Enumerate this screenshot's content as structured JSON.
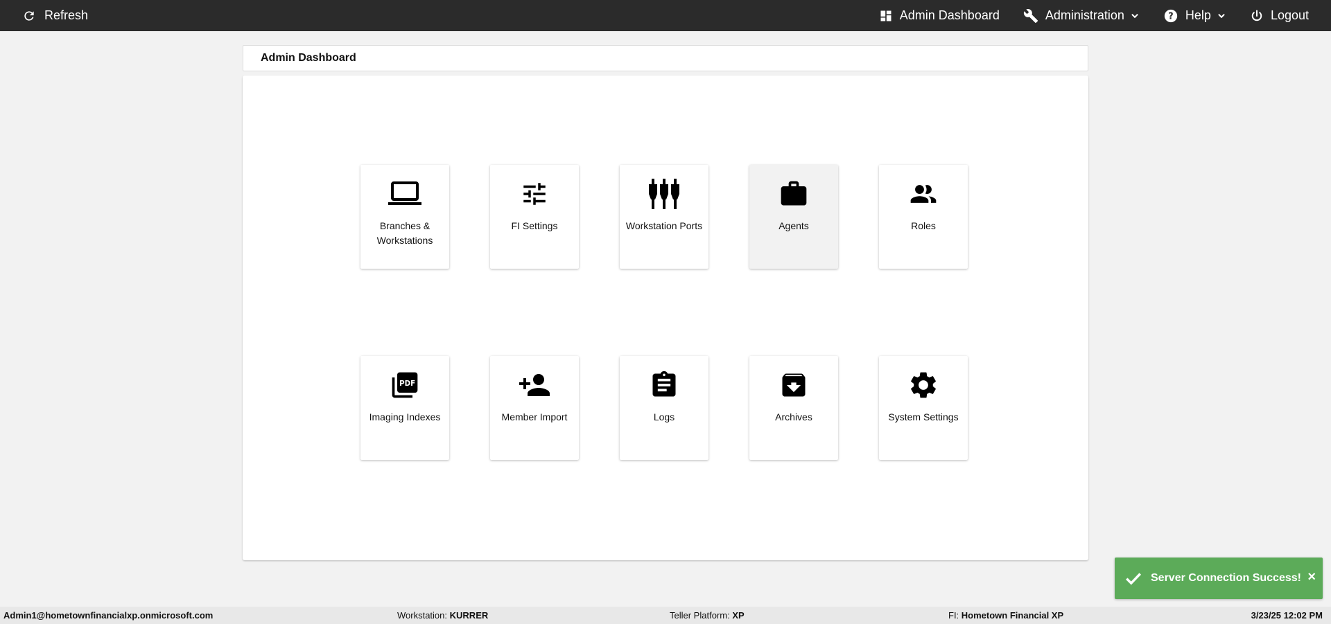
{
  "topbar": {
    "refresh_label": "Refresh",
    "nav": {
      "admin_dashboard": "Admin Dashboard",
      "administration": "Administration",
      "help": "Help",
      "logout": "Logout"
    }
  },
  "header": {
    "title": "Admin Dashboard"
  },
  "tiles": [
    {
      "label": "Branches & Workstations",
      "icon": "laptop-icon"
    },
    {
      "label": "FI Settings",
      "icon": "tune-icon"
    },
    {
      "label": "Workstation Ports",
      "icon": "ports-icon"
    },
    {
      "label": "Agents",
      "icon": "briefcase-icon"
    },
    {
      "label": "Roles",
      "icon": "people-icon"
    },
    {
      "label": "Imaging Indexes",
      "icon": "pdf-icon"
    },
    {
      "label": "Member Import",
      "icon": "person-add-icon"
    },
    {
      "label": "Logs",
      "icon": "clipboard-icon"
    },
    {
      "label": "Archives",
      "icon": "archive-icon"
    },
    {
      "label": "System Settings",
      "icon": "gear-icon"
    }
  ],
  "toast": {
    "message": "Server Connection Success!",
    "close": "×",
    "color": "#5cab59"
  },
  "status": {
    "user": "Admin1@hometownfinancialxp.onmicrosoft.com",
    "workstation_label": "Workstation:",
    "workstation_value": "KURRER",
    "platform_label": "Teller Platform:",
    "platform_value": "XP",
    "fi_label": "FI:",
    "fi_value": "Hometown Financial XP",
    "datetime": "3/23/25 12:02 PM"
  }
}
